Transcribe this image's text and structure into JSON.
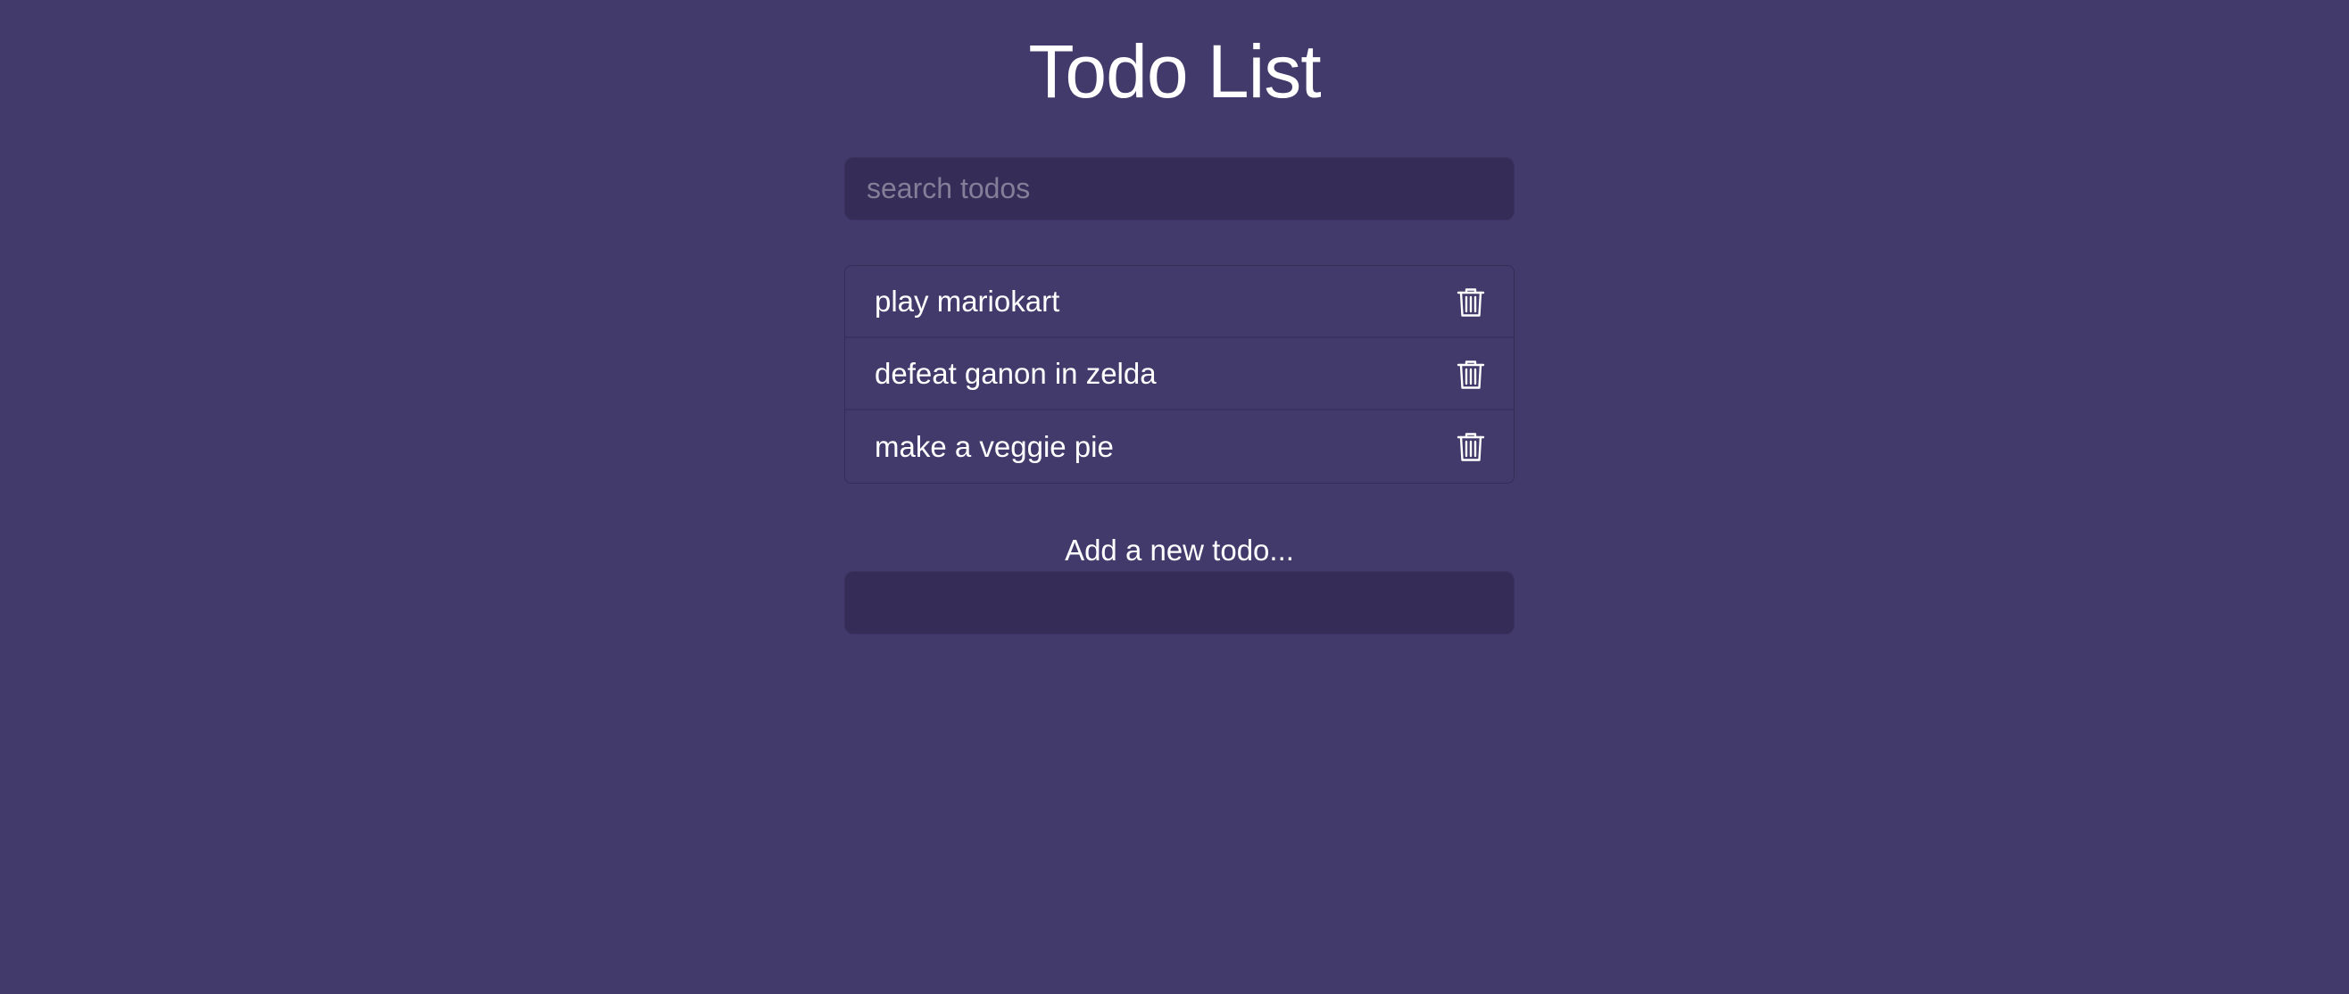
{
  "header": {
    "title": "Todo List"
  },
  "search": {
    "placeholder": "search todos",
    "value": ""
  },
  "todos": [
    {
      "text": "play mariokart",
      "icon": "trash-icon"
    },
    {
      "text": "defeat ganon in zelda",
      "icon": "trash-icon"
    },
    {
      "text": "make a veggie pie",
      "icon": "trash-icon"
    }
  ],
  "add_todo": {
    "label": "Add a new todo...",
    "value": ""
  },
  "colors": {
    "background": "#413a6b",
    "input_background": "#352d57",
    "text": "#ffffff",
    "placeholder": "#847e98"
  }
}
